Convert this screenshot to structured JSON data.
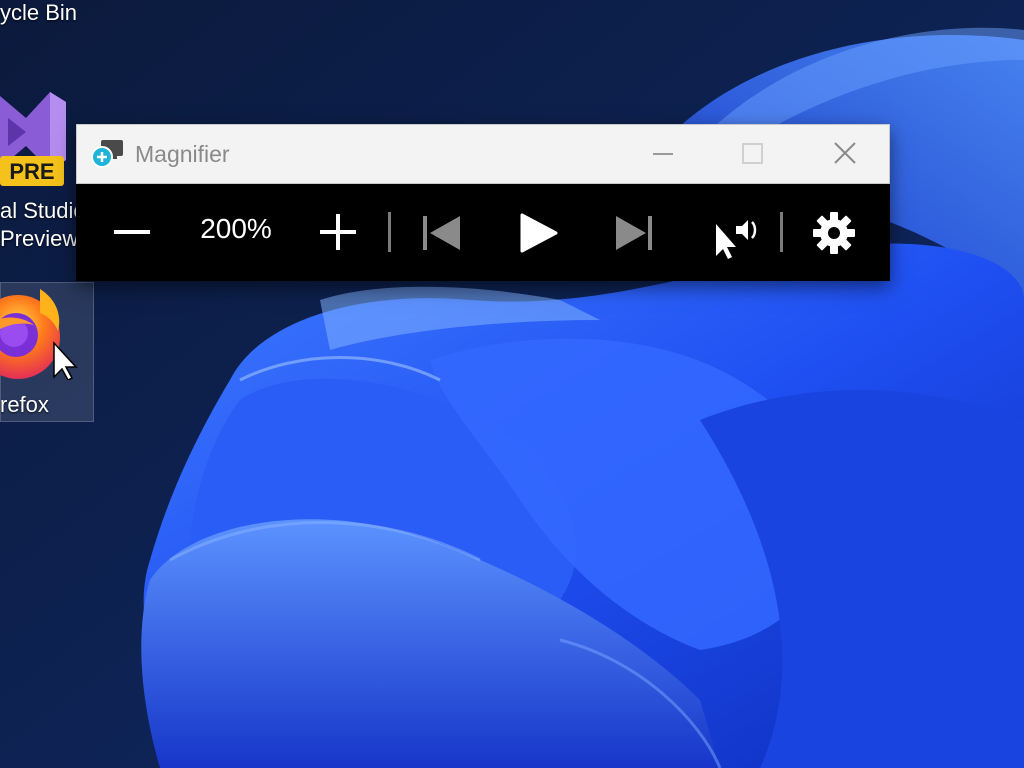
{
  "desktop": {
    "icons": [
      {
        "label": "ycle Bin"
      },
      {
        "label_line1": "al Studio",
        "label_line2": "Preview",
        "badge": "PRE",
        "icon": "visual-studio-icon"
      },
      {
        "label": "refox",
        "icon": "firefox-icon"
      }
    ]
  },
  "magnifier": {
    "title": "Magnifier",
    "title_icon": "magnifier-app-icon",
    "zoom_level": "200%",
    "buttons": [
      {
        "name": "zoom-out",
        "icon": "minus-icon"
      },
      {
        "name": "zoom-in",
        "icon": "plus-icon"
      },
      {
        "name": "previous",
        "icon": "skip-previous-icon"
      },
      {
        "name": "play",
        "icon": "play-icon"
      },
      {
        "name": "next",
        "icon": "skip-next-icon"
      },
      {
        "name": "read-from-here",
        "icon": "pointer-speaker-icon"
      },
      {
        "name": "settings",
        "icon": "gear-icon"
      }
    ]
  },
  "colors": {
    "titlebar_bg": "#f3f3f3",
    "toolbar_bg": "#000000",
    "wallpaper_accent": "#1e4ff0"
  }
}
